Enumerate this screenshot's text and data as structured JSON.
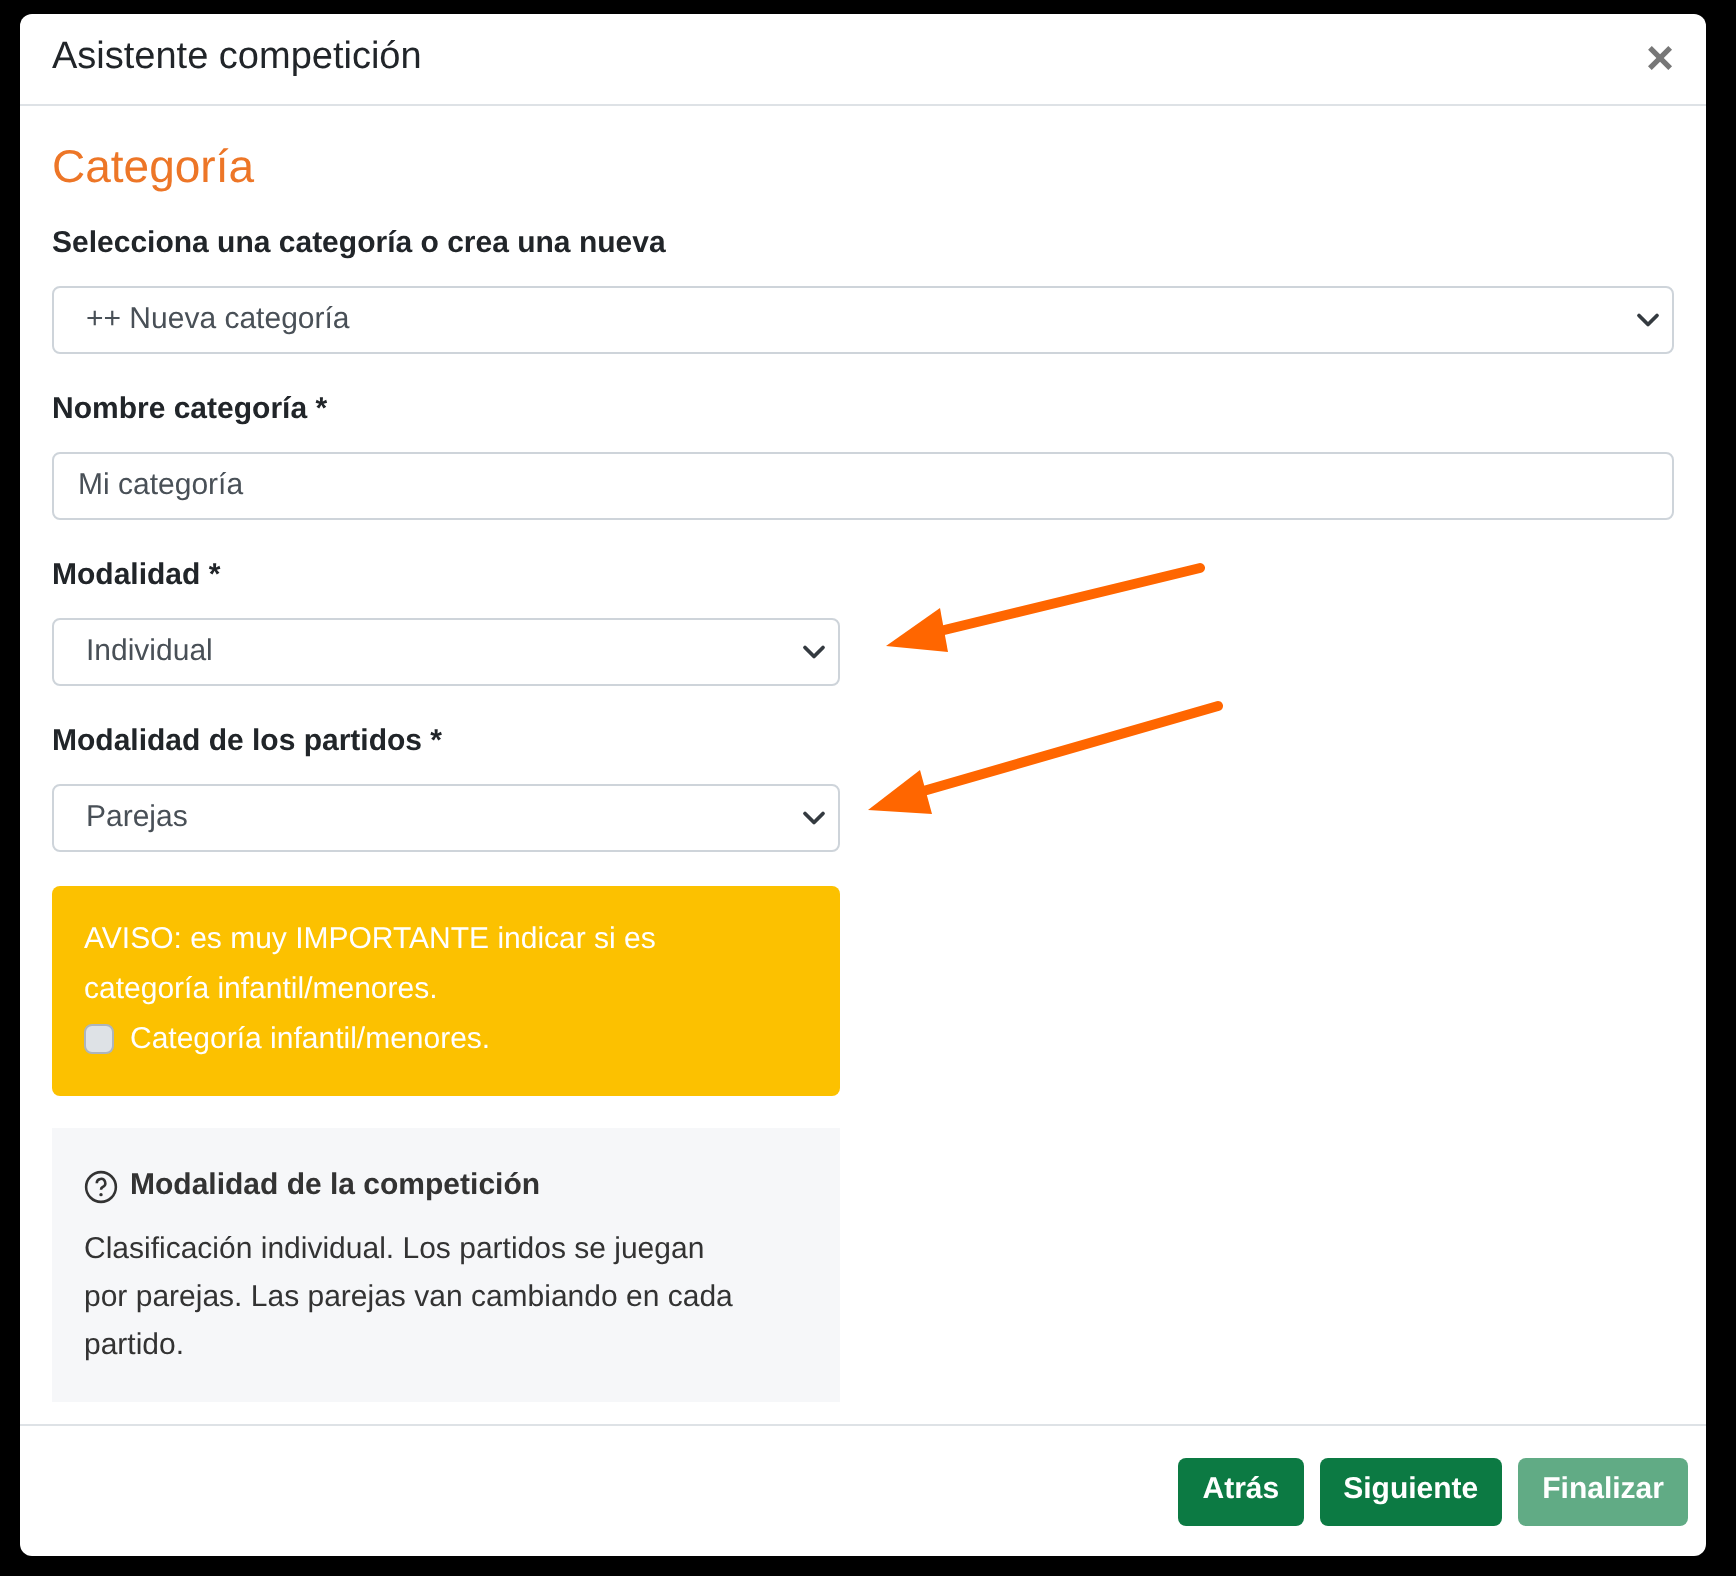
{
  "dialog": {
    "title": "Asistente competición",
    "close": "×"
  },
  "section_title": "Categoría",
  "fields": [
    {
      "kind": "select",
      "label": "Selecciona una categoría o crea una nueva",
      "value": "++ Nueva categoría",
      "wide": true
    },
    {
      "kind": "input",
      "label": "Nombre categoría *",
      "value": "Mi categoría",
      "wide": true
    },
    {
      "kind": "select",
      "label": "Modalidad *",
      "value": "Individual",
      "wide": false
    },
    {
      "kind": "select",
      "label": "Modalidad de los partidos *",
      "value": "Parejas",
      "wide": false
    }
  ],
  "warning": {
    "text": "AVISO: es muy IMPORTANTE indicar si es categoría infantil/menores.",
    "checkbox": {
      "label": "Categoría infantil/menores.",
      "checked": false
    }
  },
  "info": {
    "title": "Modalidad de la competición",
    "text": "Clasificación individual. Los partidos se juegan por parejas. Las parejas van cambiando en cada partido."
  },
  "buttons": [
    {
      "label": "Atrás",
      "disabled": false
    },
    {
      "label": "Siguiente",
      "disabled": false
    },
    {
      "label": "Finalizar",
      "disabled": true
    }
  ]
}
